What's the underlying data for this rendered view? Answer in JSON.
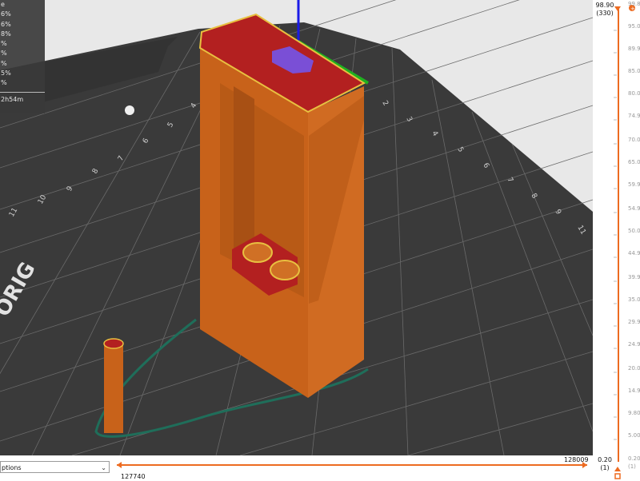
{
  "stats": {
    "lines": [
      "e",
      "6%",
      "6%",
      "8%",
      "%",
      "%",
      "%",
      "5%",
      "%"
    ],
    "time": "2h54m"
  },
  "viewport": {
    "bed_label": "ORIG",
    "bed_numbers_left": [
      "11",
      "10",
      "9",
      "8",
      "7",
      "6",
      "5",
      "4",
      "3"
    ],
    "bed_numbers_right": [
      "2",
      "3",
      "4",
      "5",
      "6",
      "7",
      "8",
      "9",
      "10",
      "11"
    ]
  },
  "vertical_slider": {
    "top_value": "98.90",
    "top_layer": "(330)",
    "bottom_value": "0.20",
    "bottom_layer": "(1)",
    "ticks": [
      "99.80",
      "95.00",
      "89.90",
      "85.00",
      "80.00",
      "74.90",
      "70.00",
      "65.00",
      "59.90",
      "54.90",
      "50.00",
      "44.90",
      "39.90",
      "35.00",
      "29.90",
      "24.90",
      "20.00",
      "14.90",
      "9.80",
      "5.00",
      "0.20",
      "(1)"
    ]
  },
  "horizontal_slider": {
    "left_value": "127740",
    "right_value": "128009"
  },
  "legend_select": {
    "value": "ptions"
  },
  "colors": {
    "accent": "#ed6b21",
    "model": "#c8621a",
    "bed": "#3a3a3a",
    "skirt": "#1f6e5a",
    "infill": "#b32020",
    "purple": "#7a4fd6",
    "axis_blue": "#1a1ae6",
    "axis_green": "#1fb11f"
  }
}
